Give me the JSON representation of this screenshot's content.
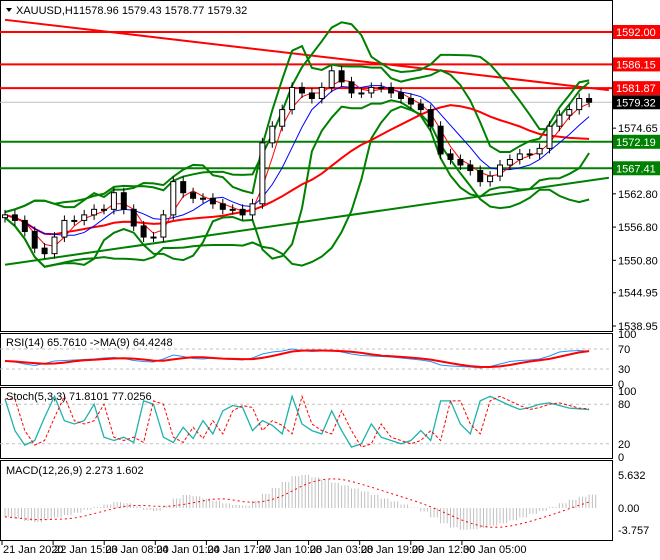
{
  "header": {
    "symbol": "XAUUSD,H1",
    "ohlc": "1578.96 1579.43 1578.77 1579.32"
  },
  "colors": {
    "red": "#ff0000",
    "green": "#008000",
    "blue": "#0000ff",
    "rsi": "#1e90ff",
    "stoch": "#20b2aa",
    "hist": "#c0c0c0"
  },
  "chart_data": {
    "type": "line",
    "title": "XAUUSD,H1",
    "ylim": [
      1538.95,
      1592.0
    ],
    "price_ticks": [
      "1574.65",
      "1562.80",
      "1556.80",
      "1550.80",
      "1544.95",
      "1538.95"
    ],
    "levels": [
      {
        "label": "1592.00",
        "value": 1592.0,
        "color": "#ff0000"
      },
      {
        "label": "1586.15",
        "value": 1586.15,
        "color": "#ff0000"
      },
      {
        "label": "1581.87",
        "value": 1581.87,
        "color": "#ff0000"
      },
      {
        "label": "1572.19",
        "value": 1572.19,
        "color": "#008000"
      },
      {
        "label": "1567.41",
        "value": 1567.41,
        "color": "#008000"
      }
    ],
    "current_price": {
      "label": "1579.32",
      "value": 1579.32
    },
    "trendlines": [
      {
        "color": "#ff0000",
        "from": [
          0,
          1594.2
        ],
        "to": [
          61,
          1581.5
        ]
      },
      {
        "color": "#008000",
        "from": [
          0,
          1550.0
        ],
        "to": [
          61,
          1565.7
        ]
      }
    ],
    "closes": [
      1559,
      1558,
      1556,
      1553,
      1552,
      1555,
      1558,
      1558,
      1559,
      1560,
      1560,
      1563,
      1560,
      1557,
      1555,
      1555,
      1559,
      1565,
      1563,
      1562,
      1562,
      1561,
      1560,
      1560,
      1559,
      1561,
      1572,
      1575,
      1578,
      1582,
      1581,
      1580,
      1582,
      1585,
      1583,
      1581,
      1581,
      1582,
      1582,
      1581,
      1580,
      1579,
      1578,
      1575,
      1570,
      1569,
      1568,
      1567,
      1565,
      1566,
      1568,
      1569,
      1570,
      1570,
      1571,
      1575,
      1577,
      1578,
      1580,
      1579.32
    ],
    "rsi": {
      "label": "RSI(14) 65.7610  ->MA(9) 64.4248",
      "levels": [
        "100",
        "70",
        "30",
        "0"
      ],
      "values": [
        46,
        44,
        40,
        37,
        41,
        46,
        47,
        48,
        49,
        50,
        52,
        53,
        51,
        47,
        45,
        44,
        50,
        58,
        55,
        51,
        50,
        52,
        50,
        49,
        48,
        52,
        60,
        64,
        66,
        70,
        67,
        65,
        66,
        68,
        64,
        60,
        57,
        56,
        55,
        54,
        52,
        50,
        48,
        45,
        38,
        36,
        35,
        34,
        32,
        35,
        40,
        45,
        47,
        48,
        50,
        56,
        64,
        66,
        67,
        65.76
      ]
    },
    "stoch": {
      "label": "Stoch(5,3,3) 71.8101 77.0256",
      "levels": [
        "100",
        "80",
        "20",
        "0"
      ],
      "values": [
        88,
        40,
        18,
        25,
        60,
        92,
        55,
        50,
        55,
        80,
        30,
        25,
        30,
        22,
        85,
        80,
        30,
        22,
        45,
        28,
        55,
        35,
        70,
        78,
        75,
        40,
        55,
        48,
        35,
        92,
        50,
        40,
        35,
        70,
        40,
        15,
        20,
        50,
        30,
        25,
        20,
        25,
        40,
        25,
        85,
        85,
        50,
        35,
        85,
        92,
        85,
        78,
        72,
        75,
        80,
        82,
        78,
        74,
        73,
        71.81
      ]
    },
    "macd": {
      "label": "MACD(12,26,9) 2.273 1.602",
      "levels": [
        "5.632",
        "0.00",
        "-3.757"
      ],
      "values": [
        -1.5,
        -1.8,
        -2.2,
        -2.4,
        -2.0,
        -1.6,
        -1.2,
        -0.8,
        -0.3,
        0.2,
        0.6,
        1.0,
        0.8,
        0.3,
        -0.3,
        -0.5,
        0.3,
        1.6,
        2.2,
        2.0,
        1.6,
        1.2,
        0.8,
        0.5,
        0.4,
        1.2,
        2.4,
        3.4,
        4.4,
        5.4,
        5.6,
        5.2,
        4.8,
        4.3,
        3.8,
        3.3,
        2.8,
        2.2,
        1.6,
        1.1,
        0.6,
        0.1,
        -0.6,
        -1.6,
        -2.6,
        -3.3,
        -3.7,
        -3.6,
        -3.4,
        -3.0,
        -2.6,
        -2.1,
        -1.6,
        -1.0,
        -0.5,
        0.2,
        0.8,
        1.4,
        1.9,
        2.27
      ]
    }
  },
  "time_axis": [
    "21 Jan 2020",
    "22 Jan 15:00",
    "23 Jan 08:00",
    "24 Jan 01:00",
    "24 Jan 17:00",
    "27 Jan 10:00",
    "28 Jan 03:00",
    "28 Jan 19:00",
    "29 Jan 12:00",
    "30 Jan 05:00"
  ]
}
